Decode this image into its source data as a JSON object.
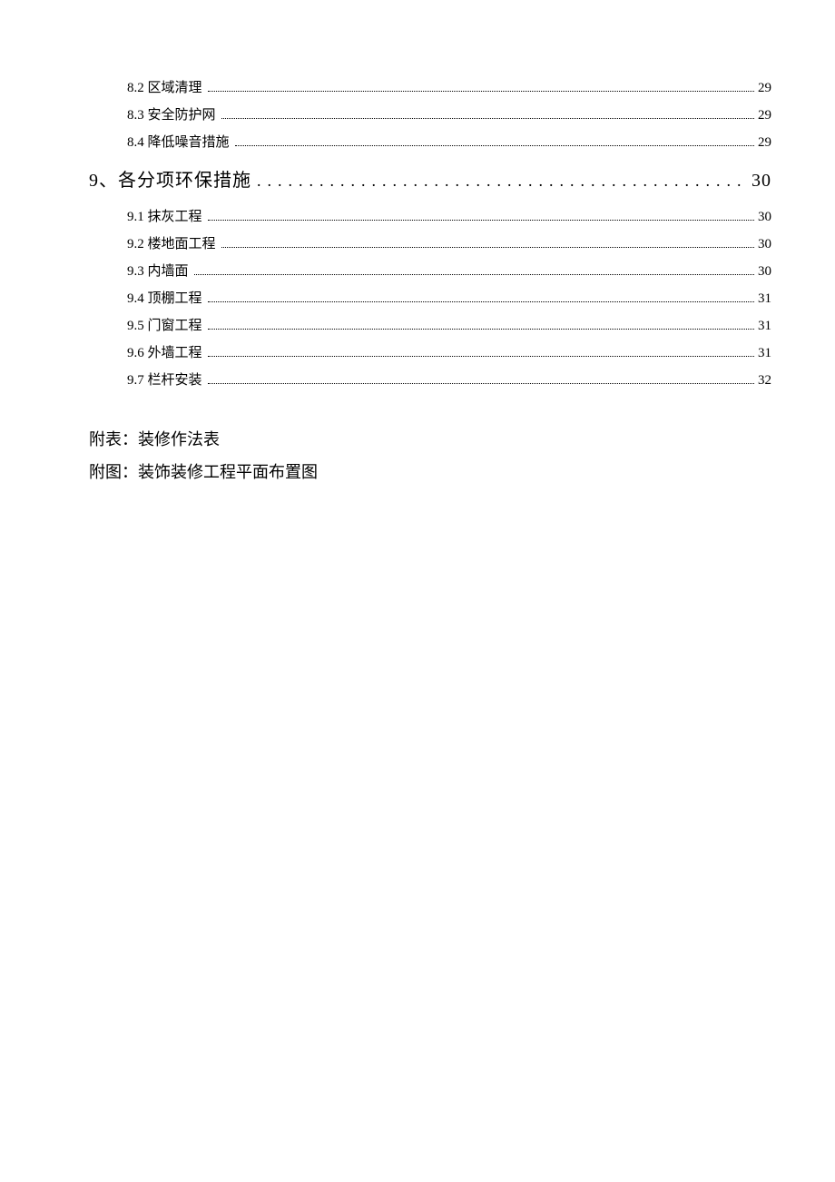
{
  "toc": {
    "preItems": [
      {
        "label": "8.2 区域清理",
        "page": "29"
      },
      {
        "label": "8.3 安全防护网",
        "page": "29"
      },
      {
        "label": "8.4 降低噪音措施",
        "page": "29"
      }
    ],
    "section9": {
      "label": "9、各分项环保措施",
      "page": "30",
      "items": [
        {
          "label": "9.1 抹灰工程",
          "page": "30"
        },
        {
          "label": "9.2 楼地面工程",
          "page": "30"
        },
        {
          "label": "9.3 内墙面",
          "page": "30"
        },
        {
          "label": "9.4 顶棚工程",
          "page": "31"
        },
        {
          "label": "9.5 门窗工程",
          "page": "31"
        },
        {
          "label": "9.6 外墙工程",
          "page": "31"
        },
        {
          "label": "9.7 栏杆安装",
          "page": "32"
        }
      ]
    }
  },
  "appendix": {
    "line1": "附表：装修作法表",
    "line2": "附图：装饰装修工程平面布置图"
  },
  "dotsWide": "................................................"
}
